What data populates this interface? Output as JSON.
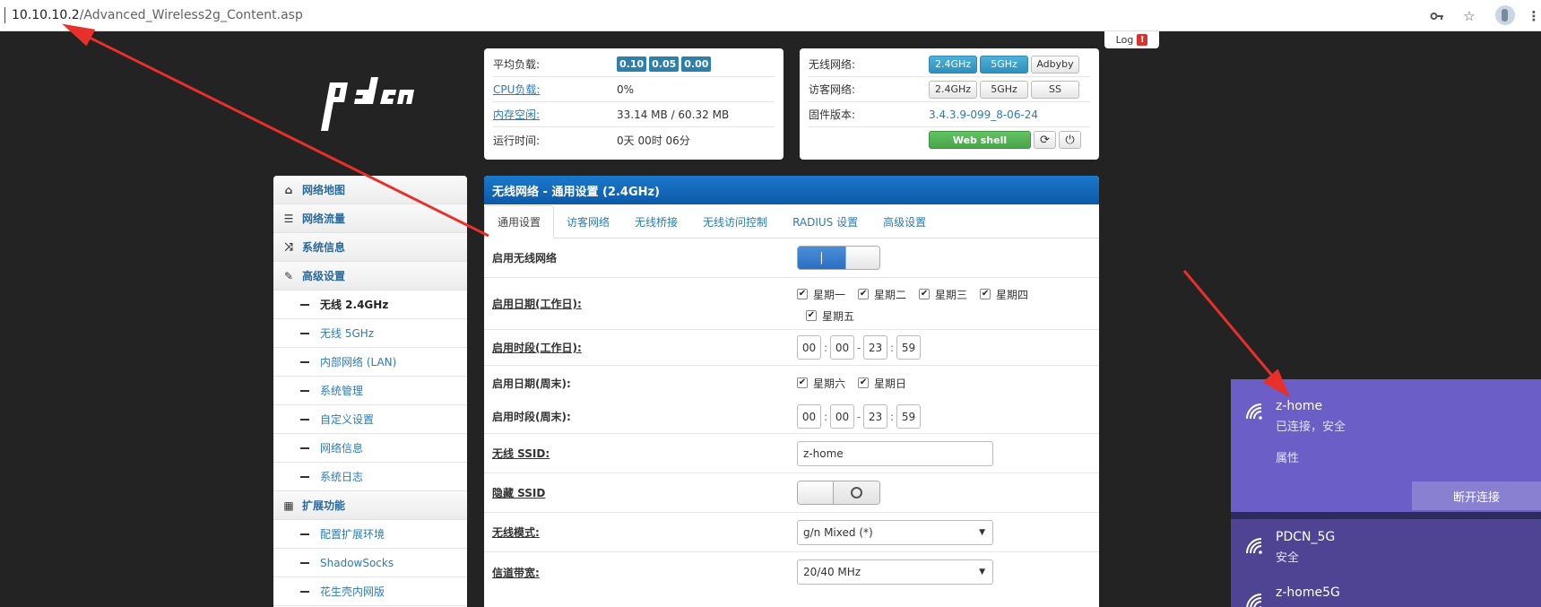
{
  "browser": {
    "url_host": "10.10.10.2",
    "url_path": "/Advanced_Wireless2g_Content.asp",
    "icons": [
      "key-icon",
      "star-icon",
      "profile-avatar",
      "menu-dots-icon"
    ]
  },
  "log": {
    "label": "Log",
    "alert": "!"
  },
  "logo": {
    "text": "pdcn"
  },
  "sysinfo": {
    "load_label": "平均负载:",
    "load_values": [
      "0.10",
      "0.05",
      "0.00"
    ],
    "cpu_label": "CPU负载:",
    "cpu_value": "0%",
    "mem_label": "内存空闲:",
    "mem_value": "33.14 MB / 60.32 MB",
    "uptime_label": "运行时间:",
    "uptime_value": "0天 00时 06分"
  },
  "netinfo": {
    "wireless_label": "无线网络:",
    "wireless_buttons": [
      "2.4GHz",
      "5GHz",
      "Adbyby"
    ],
    "guest_label": "访客网络:",
    "guest_buttons": [
      "2.4GHz",
      "5GHz",
      "SS"
    ],
    "firmware_label": "固件版本:",
    "firmware_value": "3.4.3.9-099_8-06-24",
    "webshell_label": "Web shell",
    "icons": [
      "refresh-icon",
      "power-icon"
    ]
  },
  "sidebar": {
    "items": [
      {
        "label": "网络地图",
        "type": "top",
        "icon": "home-icon"
      },
      {
        "label": "网络流量",
        "type": "top",
        "icon": "traffic-icon"
      },
      {
        "label": "系统信息",
        "type": "top",
        "icon": "shuffle-icon"
      },
      {
        "label": "高级设置",
        "type": "top",
        "icon": "wrench-icon"
      },
      {
        "label": "无线 2.4GHz",
        "type": "sub",
        "current": true
      },
      {
        "label": "无线 5GHz",
        "type": "sub"
      },
      {
        "label": "内部网络 (LAN)",
        "type": "sub"
      },
      {
        "label": "系统管理",
        "type": "sub"
      },
      {
        "label": "自定义设置",
        "type": "sub"
      },
      {
        "label": "网络信息",
        "type": "sub"
      },
      {
        "label": "系统日志",
        "type": "sub"
      },
      {
        "label": "扩展功能",
        "type": "top",
        "icon": "grid-icon"
      },
      {
        "label": "配置扩展环境",
        "type": "sub"
      },
      {
        "label": "ShadowSocks",
        "type": "sub"
      },
      {
        "label": "花生壳内网版",
        "type": "sub"
      }
    ]
  },
  "main": {
    "title": "无线网络 - 通用设置 (2.4GHz)",
    "tabs": [
      "通用设置",
      "访客网络",
      "无线桥接",
      "无线访问控制",
      "RADIUS 设置",
      "高级设置"
    ],
    "fields": {
      "enable_wireless": {
        "label": "启用无线网络",
        "value": "on"
      },
      "weekday_days": {
        "label": "启用日期(工作日):",
        "options": [
          "星期一",
          "星期二",
          "星期三",
          "星期四",
          "星期五"
        ]
      },
      "weekday_time": {
        "label": "启用时段(工作日):",
        "values": [
          "00",
          "00",
          "23",
          "59"
        ]
      },
      "weekend_days": {
        "label": "启用日期(周末):",
        "options": [
          "星期六",
          "星期日"
        ]
      },
      "weekend_time": {
        "label": "启用时段(周末):",
        "values": [
          "00",
          "00",
          "23",
          "59"
        ]
      },
      "ssid": {
        "label": "无线 SSID:",
        "value": "z-home"
      },
      "hide_ssid": {
        "label": "隐藏 SSID",
        "value": "off"
      },
      "mode": {
        "label": "无线模式:",
        "value": "g/n Mixed (*)"
      },
      "bandwidth": {
        "label": "信道带宽:",
        "value": "20/40 MHz"
      }
    }
  },
  "wifi_flyout": {
    "networks": [
      {
        "ssid": "z-home",
        "status": "已连接，安全",
        "properties": "属性",
        "action": "断开连接"
      },
      {
        "ssid": "PDCN_5G",
        "status": "安全"
      },
      {
        "ssid": "z-home5G"
      }
    ]
  },
  "colors": {
    "header_blue": "#0d5aa8",
    "badge_blue": "#2f7fa8",
    "wifi_selected": "#6b5fc7",
    "annotation_red": "#e8302a"
  }
}
